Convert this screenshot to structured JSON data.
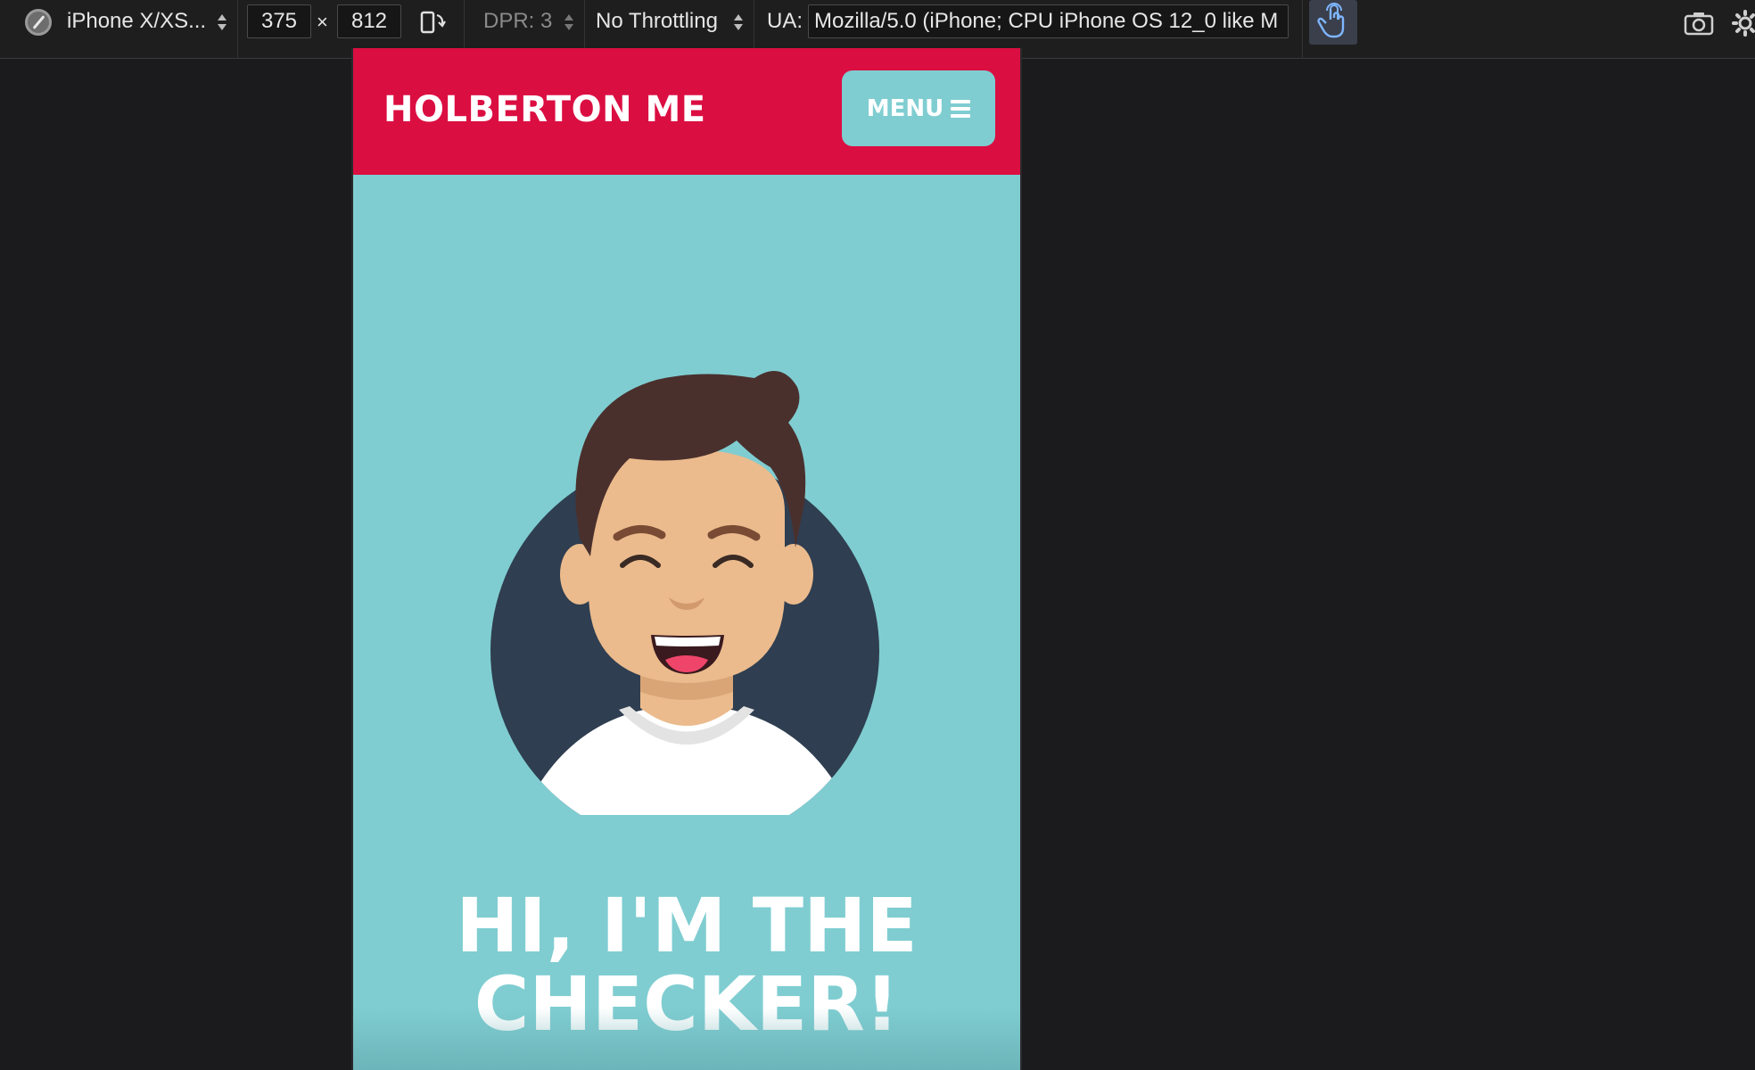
{
  "devtools": {
    "device_name": "iPhone X/XS...",
    "width_value": "375",
    "times_sign": "×",
    "height_value": "812",
    "dpr_label": "DPR: 3",
    "throttling_label": "No Throttling",
    "ua_label": "UA:",
    "ua_value": "Mozilla/5.0 (iPhone; CPU iPhone OS 12_0 like M",
    "icons": [
      "compass-icon",
      "rotate-device-icon",
      "touch-simulation-icon",
      "screenshot-camera-icon",
      "settings-gear-icon"
    ]
  },
  "site": {
    "brand": "HOLBERTON ME",
    "menu_label": "MENU",
    "hero_title_line1": "HI, I'M THE",
    "hero_title_line2": "CHECKER!",
    "colors": {
      "header_red": "#db0e42",
      "teal": "#7fcdd1",
      "avatar_circle": "#2f3e50",
      "hair": "#4a302d",
      "skin": "#ebbb8d"
    }
  }
}
